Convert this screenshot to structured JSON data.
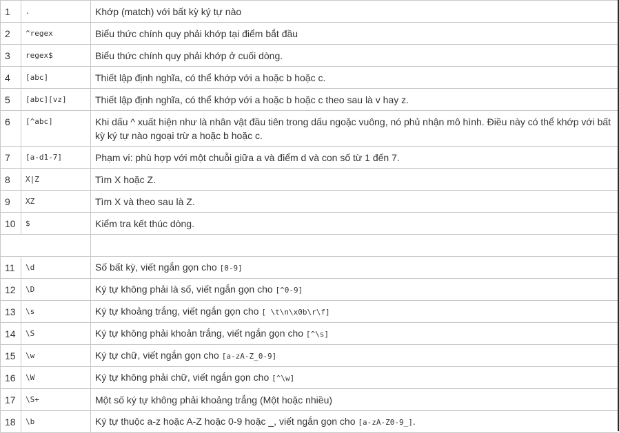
{
  "rows_top": [
    {
      "num": "1",
      "pattern": ".",
      "desc": "Khớp (match) với bất kỳ ký tự nào",
      "code": ""
    },
    {
      "num": "2",
      "pattern": "^regex",
      "desc": "Biểu thức chính quy phải  khớp tại điểm bắt đầu",
      "code": ""
    },
    {
      "num": "3",
      "pattern": "regex$",
      "desc": "Biểu thức chính quy phải khớp ở cuối dòng.",
      "code": ""
    },
    {
      "num": "4",
      "pattern": "[abc]",
      "desc": "Thiết lập định nghĩa, có thể khớp với a hoặc b hoặc c.",
      "code": ""
    },
    {
      "num": "5",
      "pattern": "[abc][vz]",
      "desc": "Thiết lập định nghĩa, có thể khớp với a hoặc b hoặc c theo sau là v hay z.",
      "code": ""
    },
    {
      "num": "6",
      "pattern": "[^abc]",
      "desc": "Khi dấu ^ xuất hiện như là nhân vật đầu tiên trong dấu ngoặc vuông, nó phủ nhận mô hình. Điều này có thể khớp với bất kỳ ký tự nào ngoại trừ a hoặc b hoặc c.",
      "code": ""
    },
    {
      "num": "7",
      "pattern": "[a-d1-7]",
      "desc": "Phạm vi: phù hợp với một chuỗi giữa a và điểm d và con số từ 1 đến 7.",
      "code": ""
    },
    {
      "num": "8",
      "pattern": "X|Z",
      "desc": "Tìm X hoặc Z.",
      "code": ""
    },
    {
      "num": "9",
      "pattern": "XZ",
      "desc": "Tìm X và theo sau là Z.",
      "code": ""
    },
    {
      "num": "10",
      "pattern": "$",
      "desc": "Kiểm tra kết thúc dòng.",
      "code": ""
    }
  ],
  "rows_bottom": [
    {
      "num": "11",
      "pattern": "\\d",
      "desc": "Số bất kỳ, viết ngắn gọn cho ",
      "code": "[0-9]",
      "tail": ""
    },
    {
      "num": "12",
      "pattern": "\\D",
      "desc": "Ký tự không phải là số, viết ngắn gọn cho ",
      "code": "[^0-9]",
      "tail": ""
    },
    {
      "num": "13",
      "pattern": "\\s",
      "desc": "Ký tự khoảng trắng, viết ngắn gọn cho ",
      "code": "[ \\t\\n\\x0b\\r\\f]",
      "tail": ""
    },
    {
      "num": "14",
      "pattern": "\\S",
      "desc": "Ký tự không phải khoản trắng, viết ngắn gọn cho ",
      "code": "[^\\s]",
      "tail": ""
    },
    {
      "num": "15",
      "pattern": "\\w",
      "desc": "Ký tự chữ, viết ngắn gọn cho ",
      "code": "[a-zA-Z_0-9]",
      "tail": ""
    },
    {
      "num": "16",
      "pattern": "\\W",
      "desc": "Ký tự không phải chữ, viết ngắn gọn cho ",
      "code": "[^\\w]",
      "tail": ""
    },
    {
      "num": "17",
      "pattern": "\\S+",
      "desc": "Một số ký tự không phải khoảng trắng (Một hoặc nhiều)",
      "code": "",
      "tail": ""
    },
    {
      "num": "18",
      "pattern": "\\b",
      "desc": "Ký tự thuộc a-z hoặc A-Z hoặc 0-9 hoặc _, viết ngắn gọn cho ",
      "code": "[a-zA-Z0-9_]",
      "tail": "."
    }
  ]
}
